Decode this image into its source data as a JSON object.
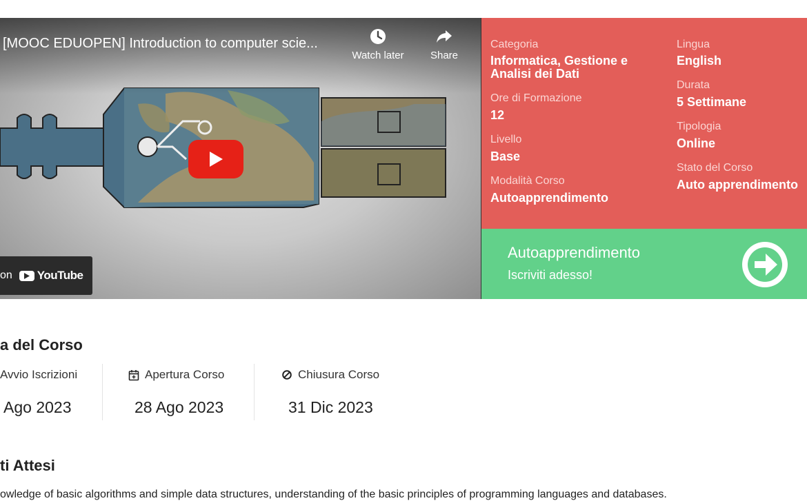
{
  "video": {
    "title": "[MOOC EDUOPEN] Introduction to computer scie...",
    "watch_later_label": "Watch later",
    "share_label": "Share",
    "watch_on_label": "on",
    "youtube_label": "YouTube"
  },
  "course_info": {
    "categoria_label": "Categoria",
    "categoria_value": "Informatica, Gestione e Analisi dei Dati",
    "ore_label": "Ore di Formazione",
    "ore_value": "12",
    "livello_label": "Livello",
    "livello_value": "Base",
    "modalita_label": "Modalità Corso",
    "modalita_value": "Autoapprendimento",
    "lingua_label": "Lingua",
    "lingua_value": "English",
    "durata_label": "Durata",
    "durata_value": "5 Settimane",
    "tipologia_label": "Tipologia",
    "tipologia_value": "Online",
    "stato_label": "Stato del Corso",
    "stato_value": "Auto apprendimento"
  },
  "enroll": {
    "title": "Autoapprendimento",
    "subtitle": "Iscriviti adesso!"
  },
  "calendar": {
    "title": "a del Corso",
    "avvio_label": "Avvio Iscrizioni",
    "avvio_value": "Ago 2023",
    "apertura_label": "Apertura Corso",
    "apertura_value": "28 Ago 2023",
    "chiusura_label": "Chiusura Corso",
    "chiusura_value": "31 Dic 2023"
  },
  "outcomes": {
    "title": "ti Attesi",
    "text": "owledge of basic algorithms and simple data structures, understanding of the basic principles of programming languages and databases."
  },
  "colors": {
    "info_panel": "#e35e59",
    "enroll_panel": "#62d18a",
    "youtube_red": "#e62117"
  }
}
